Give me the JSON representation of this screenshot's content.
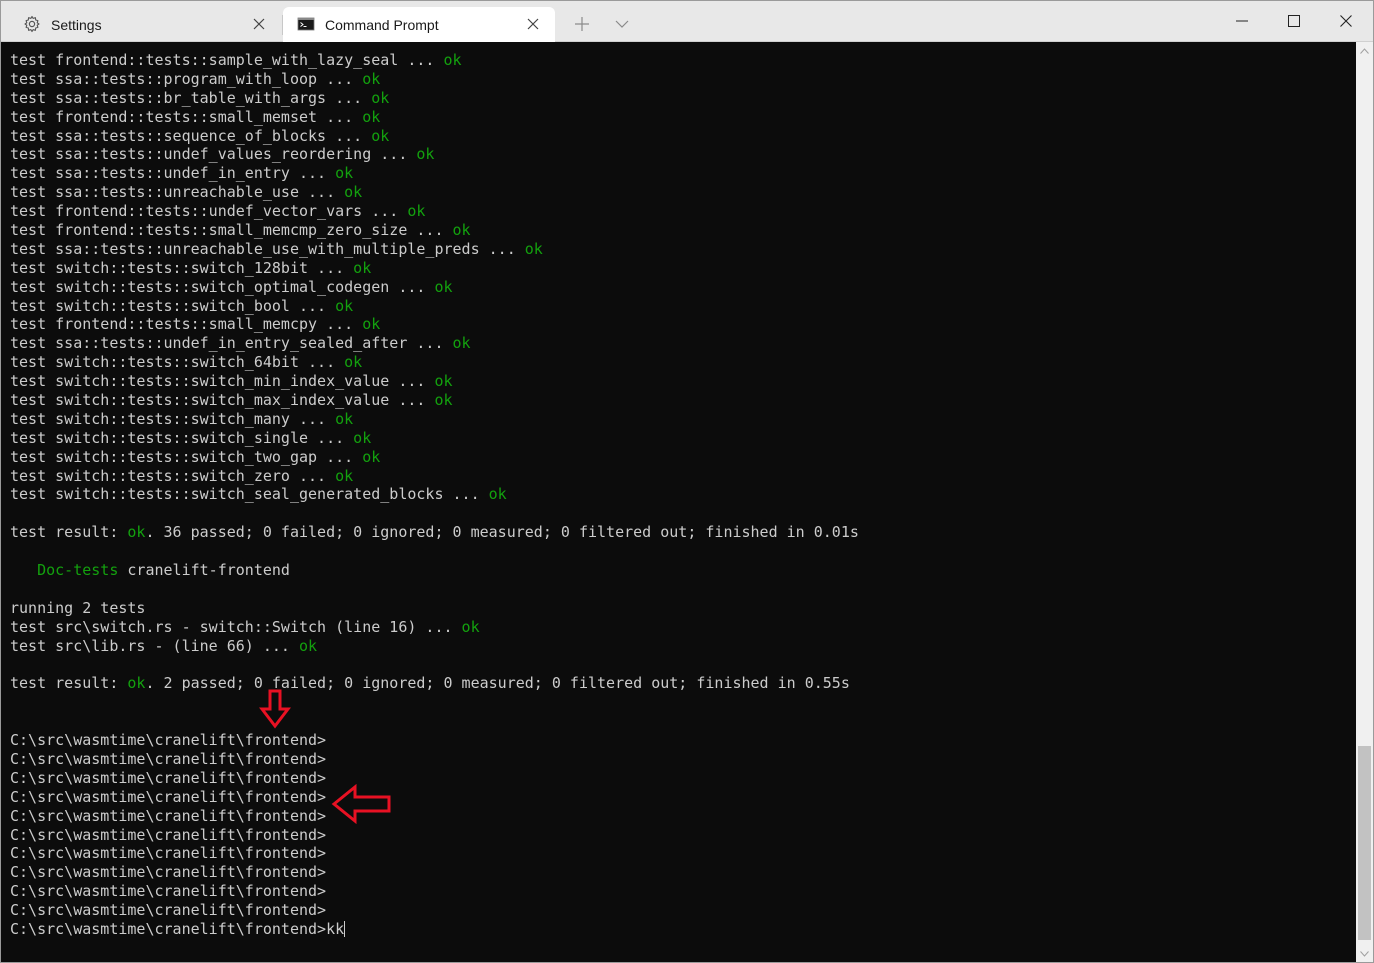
{
  "tabs": [
    {
      "label": "Settings",
      "icon": "gear-icon",
      "active": false
    },
    {
      "label": "Command Prompt",
      "icon": "cmd-icon",
      "active": true
    }
  ],
  "terminal": {
    "lines": [
      {
        "text": "test frontend::tests::sample_with_lazy_seal ... ",
        "status": "ok"
      },
      {
        "text": "test ssa::tests::program_with_loop ... ",
        "status": "ok"
      },
      {
        "text": "test ssa::tests::br_table_with_args ... ",
        "status": "ok"
      },
      {
        "text": "test frontend::tests::small_memset ... ",
        "status": "ok"
      },
      {
        "text": "test ssa::tests::sequence_of_blocks ... ",
        "status": "ok"
      },
      {
        "text": "test ssa::tests::undef_values_reordering ... ",
        "status": "ok"
      },
      {
        "text": "test ssa::tests::undef_in_entry ... ",
        "status": "ok"
      },
      {
        "text": "test ssa::tests::unreachable_use ... ",
        "status": "ok"
      },
      {
        "text": "test frontend::tests::undef_vector_vars ... ",
        "status": "ok"
      },
      {
        "text": "test frontend::tests::small_memcmp_zero_size ... ",
        "status": "ok"
      },
      {
        "text": "test ssa::tests::unreachable_use_with_multiple_preds ... ",
        "status": "ok"
      },
      {
        "text": "test switch::tests::switch_128bit ... ",
        "status": "ok"
      },
      {
        "text": "test switch::tests::switch_optimal_codegen ... ",
        "status": "ok"
      },
      {
        "text": "test switch::tests::switch_bool ... ",
        "status": "ok"
      },
      {
        "text": "test frontend::tests::small_memcpy ... ",
        "status": "ok"
      },
      {
        "text": "test ssa::tests::undef_in_entry_sealed_after ... ",
        "status": "ok"
      },
      {
        "text": "test switch::tests::switch_64bit ... ",
        "status": "ok"
      },
      {
        "text": "test switch::tests::switch_min_index_value ... ",
        "status": "ok"
      },
      {
        "text": "test switch::tests::switch_max_index_value ... ",
        "status": "ok"
      },
      {
        "text": "test switch::tests::switch_many ... ",
        "status": "ok"
      },
      {
        "text": "test switch::tests::switch_single ... ",
        "status": "ok"
      },
      {
        "text": "test switch::tests::switch_two_gap ... ",
        "status": "ok"
      },
      {
        "text": "test switch::tests::switch_zero ... ",
        "status": "ok"
      },
      {
        "text": "test switch::tests::switch_seal_generated_blocks ... ",
        "status": "ok"
      },
      {
        "text": ""
      },
      {
        "text": "test result: ",
        "status": "ok",
        "suffix": ". 36 passed; 0 failed; 0 ignored; 0 measured; 0 filtered out; finished in 0.01s"
      },
      {
        "text": ""
      },
      {
        "text": "   ",
        "highlight": "Doc-tests",
        "suffix": " cranelift-frontend"
      },
      {
        "text": ""
      },
      {
        "text": "running 2 tests"
      },
      {
        "text": "test src\\switch.rs - switch::Switch (line 16) ... ",
        "status": "ok"
      },
      {
        "text": "test src\\lib.rs - (line 66) ... ",
        "status": "ok"
      },
      {
        "text": ""
      },
      {
        "text": "test result: ",
        "status": "ok",
        "suffix": ". 2 passed; 0 failed; 0 ignored; 0 measured; 0 filtered out; finished in 0.55s"
      },
      {
        "text": ""
      },
      {
        "text": ""
      },
      {
        "text": "C:\\src\\wasmtime\\cranelift\\frontend>"
      },
      {
        "text": "C:\\src\\wasmtime\\cranelift\\frontend>"
      },
      {
        "text": "C:\\src\\wasmtime\\cranelift\\frontend>"
      },
      {
        "text": "C:\\src\\wasmtime\\cranelift\\frontend>"
      },
      {
        "text": "C:\\src\\wasmtime\\cranelift\\frontend>"
      },
      {
        "text": "C:\\src\\wasmtime\\cranelift\\frontend>"
      },
      {
        "text": "C:\\src\\wasmtime\\cranelift\\frontend>"
      },
      {
        "text": "C:\\src\\wasmtime\\cranelift\\frontend>"
      },
      {
        "text": "C:\\src\\wasmtime\\cranelift\\frontend>"
      },
      {
        "text": "C:\\src\\wasmtime\\cranelift\\frontend>"
      },
      {
        "text": "C:\\src\\wasmtime\\cranelift\\frontend>kk",
        "cursor": true
      }
    ]
  },
  "colors": {
    "background": "#0c0c0c",
    "foreground": "#cccccc",
    "ok": "#13a10e",
    "annotation": "#e81123"
  },
  "window_controls": [
    "minimize-icon",
    "maximize-icon",
    "close-icon"
  ]
}
